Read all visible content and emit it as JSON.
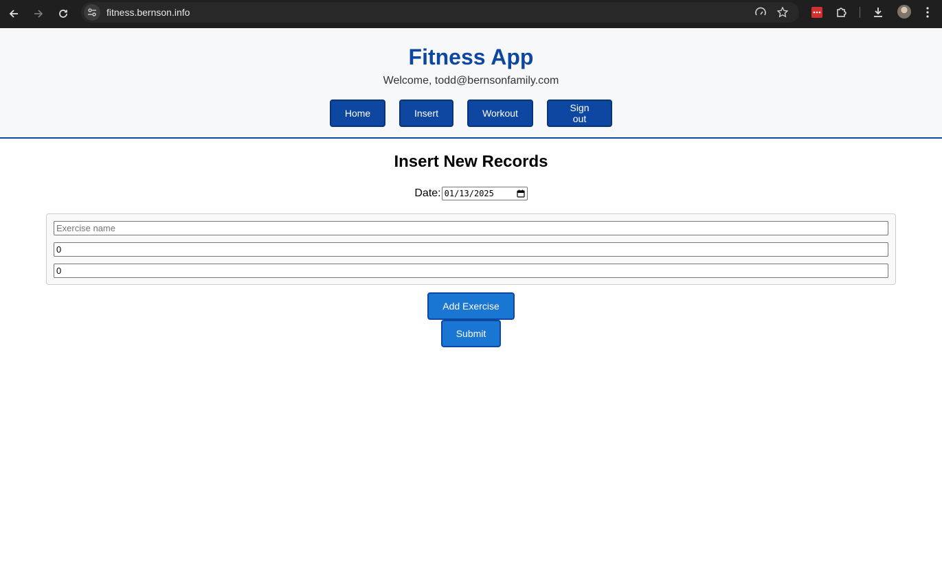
{
  "browser": {
    "url": "fitness.bernson.info",
    "icons": {
      "back": "back-arrow-icon",
      "forward": "forward-arrow-icon",
      "reload": "reload-icon",
      "site_info": "site-info-icon",
      "performance": "speed-gauge-icon",
      "bookmark": "star-icon",
      "extension_red": "password-manager-icon",
      "extensions": "puzzle-icon",
      "downloads": "download-icon",
      "profile": "avatar",
      "menu": "kebab-menu-icon"
    }
  },
  "header": {
    "title": "Fitness App",
    "welcome": "Welcome, todd@bernsonfamily.com",
    "nav": [
      {
        "label": "Home"
      },
      {
        "label": "Insert"
      },
      {
        "label": "Workout"
      },
      {
        "label": "Sign out"
      }
    ]
  },
  "main": {
    "title": "Insert New Records",
    "date_label": "Date:",
    "date_value": "01/13/2025",
    "exercise": {
      "name_placeholder": "Exercise name",
      "field2_value": "0",
      "field3_value": "0"
    },
    "add_button": "Add Exercise",
    "submit_button": "Submit"
  },
  "colors": {
    "brand": "#0d47a1",
    "button": "#1976d2",
    "header_bg": "#f7f8fa"
  }
}
